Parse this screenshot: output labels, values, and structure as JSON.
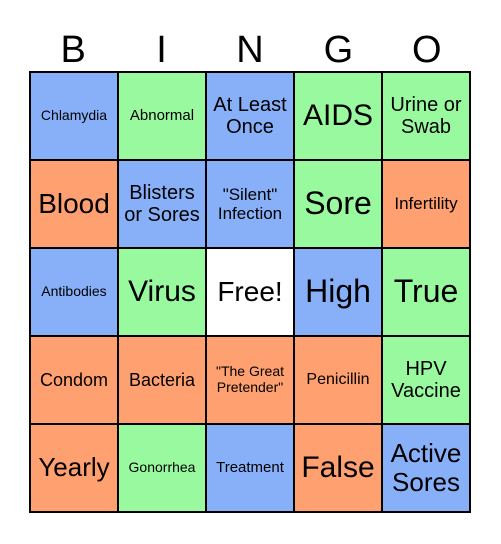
{
  "header": [
    "B",
    "I",
    "N",
    "G",
    "O"
  ],
  "colors": {
    "blue": "#88b0f8",
    "green": "#99f99f",
    "orange": "#ffa070",
    "free": "#ffffff"
  },
  "cells": [
    {
      "text": "Chlamydia",
      "color": "blue",
      "size": 14
    },
    {
      "text": "Abnormal",
      "color": "green",
      "size": 15
    },
    {
      "text": "At Least Once",
      "color": "blue",
      "size": 20
    },
    {
      "text": "AIDS",
      "color": "green",
      "size": 30
    },
    {
      "text": "Urine or Swab",
      "color": "green",
      "size": 20
    },
    {
      "text": "Blood",
      "color": "orange",
      "size": 28
    },
    {
      "text": "Blisters or Sores",
      "color": "blue",
      "size": 20
    },
    {
      "text": "\"Silent\" Infection",
      "color": "blue",
      "size": 17
    },
    {
      "text": "Sore",
      "color": "green",
      "size": 32
    },
    {
      "text": "Infertility",
      "color": "orange",
      "size": 17
    },
    {
      "text": "Antibodies",
      "color": "blue",
      "size": 14
    },
    {
      "text": "Virus",
      "color": "green",
      "size": 30
    },
    {
      "text": "Free!",
      "color": "free",
      "size": 28
    },
    {
      "text": "High",
      "color": "blue",
      "size": 32
    },
    {
      "text": "True",
      "color": "green",
      "size": 32
    },
    {
      "text": "Condom",
      "color": "orange",
      "size": 18
    },
    {
      "text": "Bacteria",
      "color": "orange",
      "size": 18
    },
    {
      "text": "\"The Great Pretender\"",
      "color": "orange",
      "size": 14
    },
    {
      "text": "Penicillin",
      "color": "orange",
      "size": 16
    },
    {
      "text": "HPV Vaccine",
      "color": "green",
      "size": 20
    },
    {
      "text": "Yearly",
      "color": "orange",
      "size": 26
    },
    {
      "text": "Gonorrhea",
      "color": "green",
      "size": 14
    },
    {
      "text": "Treatment",
      "color": "blue",
      "size": 15
    },
    {
      "text": "False",
      "color": "orange",
      "size": 30
    },
    {
      "text": "Active Sores",
      "color": "blue",
      "size": 26
    }
  ]
}
